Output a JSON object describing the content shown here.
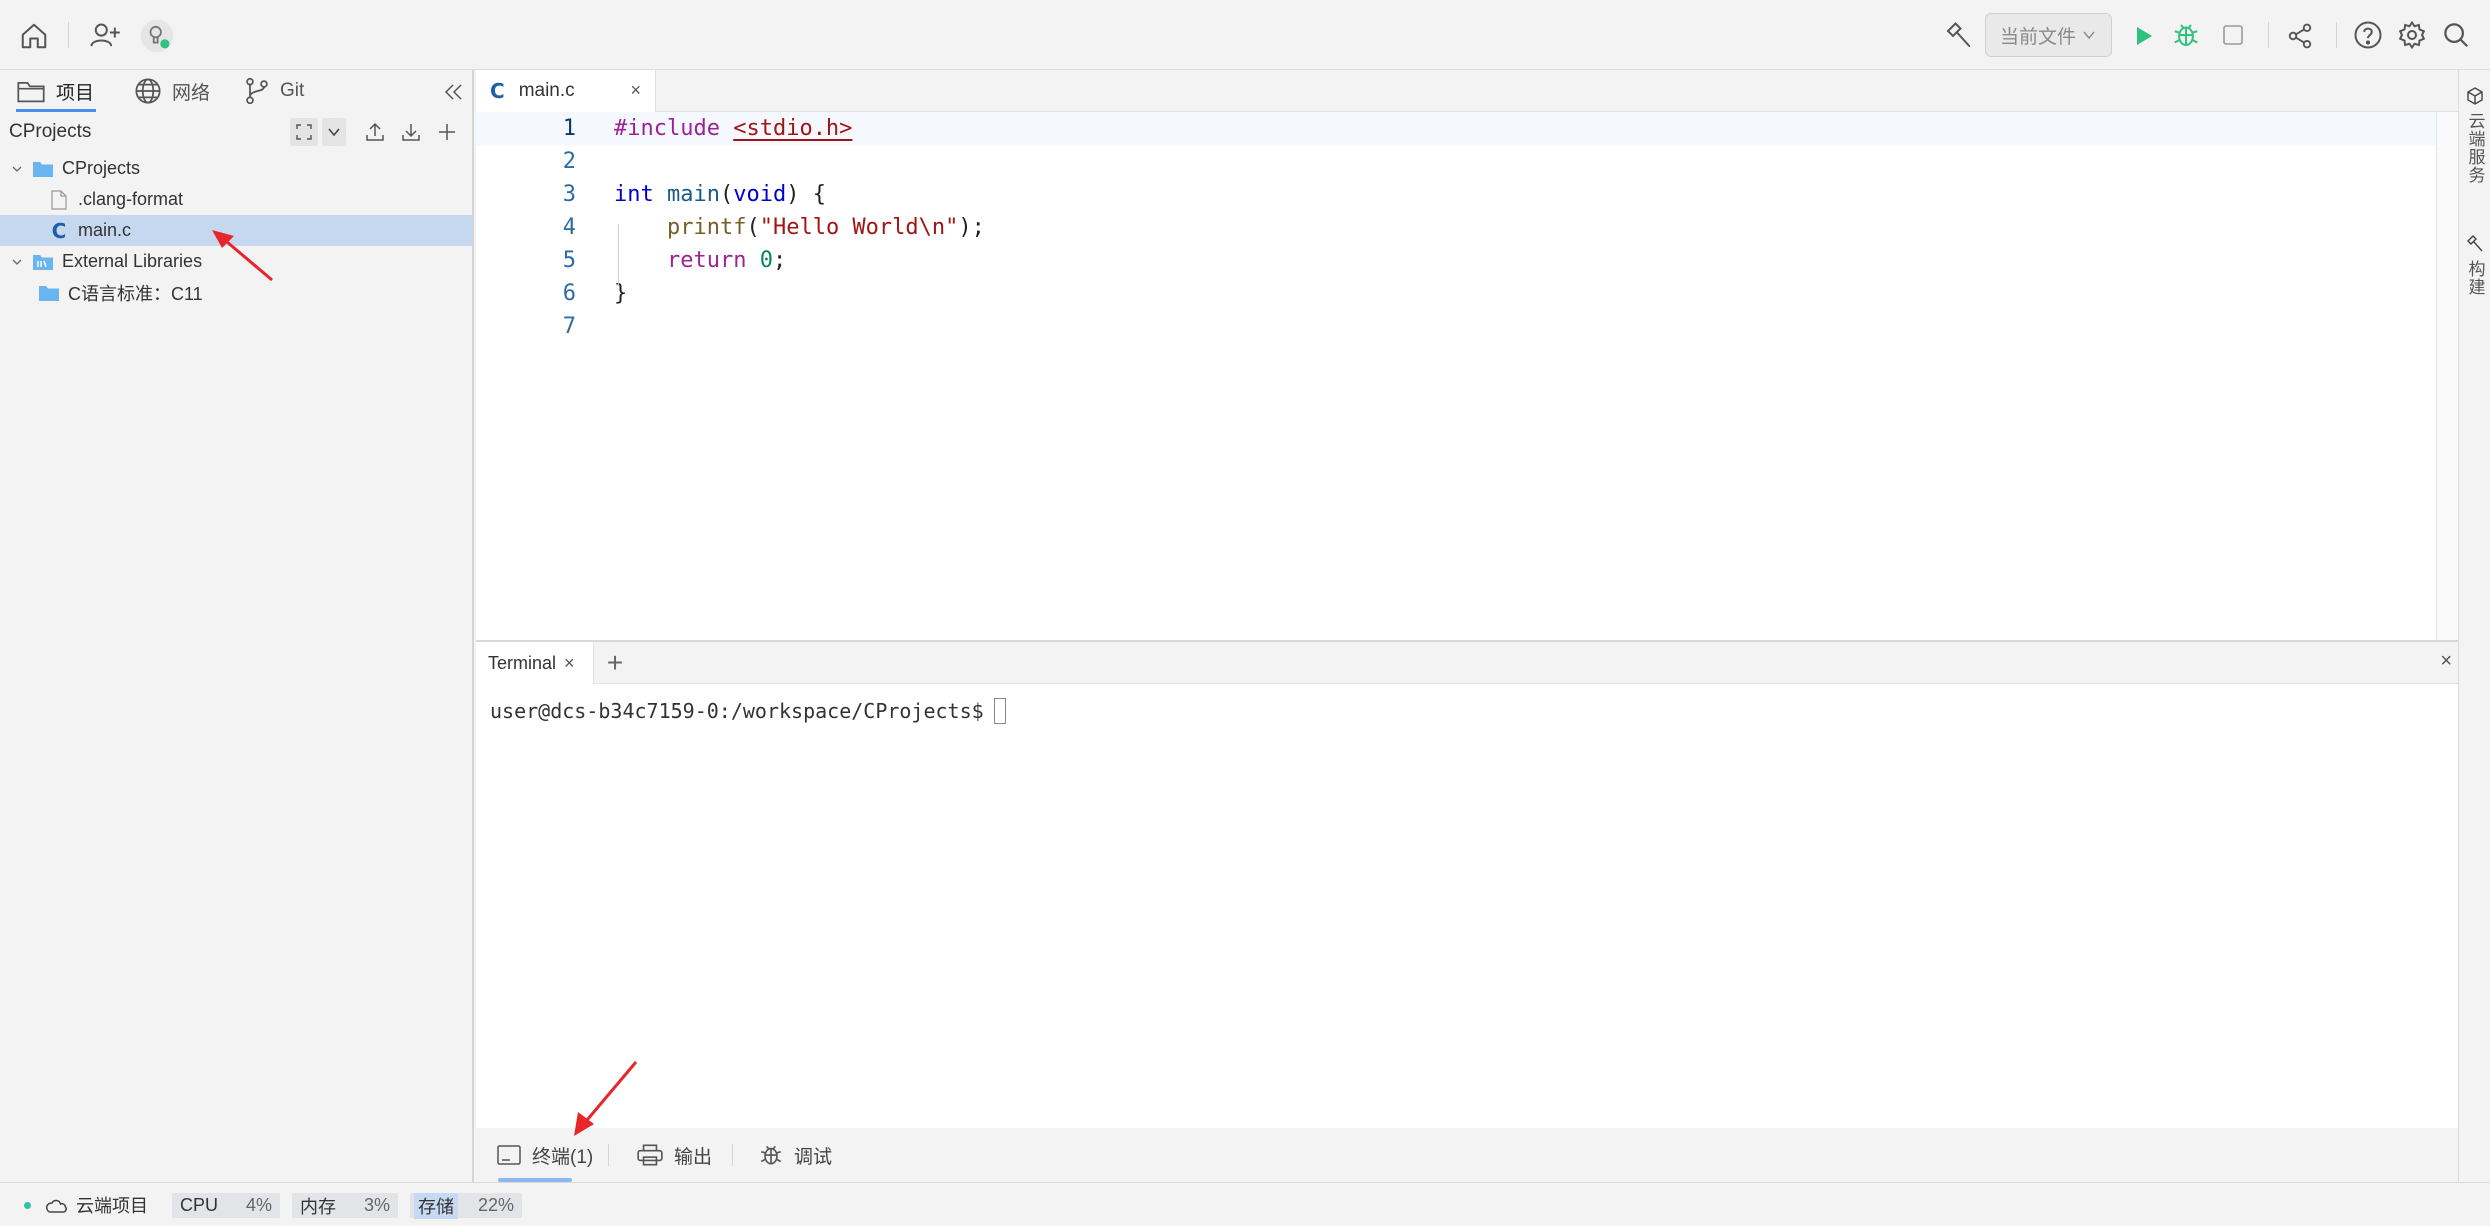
{
  "colors": {
    "accent": "#4a8ef0",
    "selection": "#c6d8f0",
    "run_green": "#2ec27e",
    "annotation_red": "#e8262a",
    "status_dot": "#2ec2a9"
  },
  "topbar": {
    "icons": [
      "home-icon",
      "add-user-icon",
      "lightbulb-icon",
      "hammer-icon",
      "run-icon",
      "debug-icon",
      "stop-icon",
      "share-icon",
      "help-icon",
      "settings-icon",
      "search-icon"
    ],
    "run_config_label": "当前文件"
  },
  "sidebar": {
    "tabs": [
      {
        "label": "项目",
        "icon": "folder-icon",
        "active": true
      },
      {
        "label": "网络",
        "icon": "globe-icon",
        "active": false
      },
      {
        "label": "Git",
        "icon": "git-branch-icon",
        "active": false
      }
    ],
    "project_header": "CProjects",
    "tree": [
      {
        "label": "CProjects",
        "type": "folder",
        "expanded": true
      },
      {
        "label": ".clang-format",
        "type": "file"
      },
      {
        "label": "main.c",
        "type": "c-file",
        "selected": true
      },
      {
        "label": "External Libraries",
        "type": "library",
        "expanded": true
      },
      {
        "label": "C语言标准：C11",
        "type": "folder"
      }
    ]
  },
  "editor": {
    "tab_label": "main.c",
    "tab_icon_glyph": "C",
    "close_glyph": "×",
    "line_numbers": [
      "1",
      "2",
      "3",
      "4",
      "5",
      "6",
      "7"
    ],
    "lines": {
      "l1_pp": "#include",
      "l1_inc": "<stdio.h>",
      "l3_kw": "int",
      "l3_fn": "main",
      "l3_p1": "(",
      "l3_kw2": "void",
      "l3_p2": ") {",
      "l4_fn": "printf",
      "l4_p1": "(",
      "l4_str": "\"Hello World\\n\"",
      "l4_p2": ");",
      "l5_kw": "return",
      "l5_num": "0",
      "l5_p": ";",
      "l6_p": "}"
    }
  },
  "right_rail": {
    "items": [
      {
        "label": "云端服务",
        "icon": "cube-icon"
      },
      {
        "label": "构建",
        "icon": "hammer-icon"
      }
    ]
  },
  "terminal": {
    "tab_label": "Terminal",
    "close_glyph": "×",
    "add_glyph": "+",
    "prompt": "user@dcs-b34c7159-0:/workspace/CProjects$"
  },
  "bottom_tools": [
    {
      "label": "终端(1)",
      "icon": "terminal-icon",
      "active": true
    },
    {
      "label": "输出",
      "icon": "printer-icon",
      "active": false
    },
    {
      "label": "调试",
      "icon": "bug-icon",
      "active": false
    }
  ],
  "statusbar": {
    "project_label": "云端项目",
    "cpu_label": "CPU",
    "cpu_value": "4%",
    "mem_label": "内存",
    "mem_value": "3%",
    "storage_label": "存储",
    "storage_value": "22%"
  }
}
